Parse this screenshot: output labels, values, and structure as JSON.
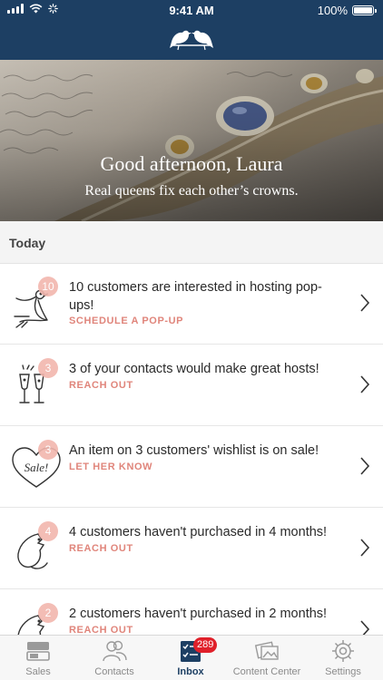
{
  "status_bar": {
    "time": "9:41 AM",
    "battery": "100%"
  },
  "hero": {
    "greeting": "Good afternoon, Laura",
    "tagline": "Real queens fix each other’s crowns."
  },
  "section": {
    "title": "Today"
  },
  "items": [
    {
      "badge": "10",
      "icon": "bird-icon",
      "title": "10 customers are interested in hosting pop-ups!",
      "action": "SCHEDULE A POP-UP"
    },
    {
      "badge": "3",
      "icon": "champagne-glasses-icon",
      "title": "3 of your contacts would make great hosts!",
      "action": "REACH OUT"
    },
    {
      "badge": "3",
      "icon": "sale-heart-icon",
      "title": "An item on 3 customers' wishlist is on sale!",
      "action": "LET HER KNOW"
    },
    {
      "badge": "4",
      "icon": "dog-icon",
      "title": "4 customers haven't purchased in 4 months!",
      "action": "REACH OUT"
    },
    {
      "badge": "2",
      "icon": "dog-icon",
      "title": "2 customers haven't purchased in 2 months!",
      "action": "REACH OUT"
    }
  ],
  "tabs": [
    {
      "label": "Sales",
      "icon": "sales-icon"
    },
    {
      "label": "Contacts",
      "icon": "contacts-icon"
    },
    {
      "label": "Inbox",
      "icon": "inbox-checklist-icon",
      "badge": "289",
      "active": true
    },
    {
      "label": "Content Center",
      "icon": "photos-icon"
    },
    {
      "label": "Settings",
      "icon": "gear-icon"
    }
  ],
  "colors": {
    "navbar": "#1d3f63",
    "accent": "#e0857b",
    "badge": "#f2b6ae",
    "tab_badge": "#e0202a"
  }
}
